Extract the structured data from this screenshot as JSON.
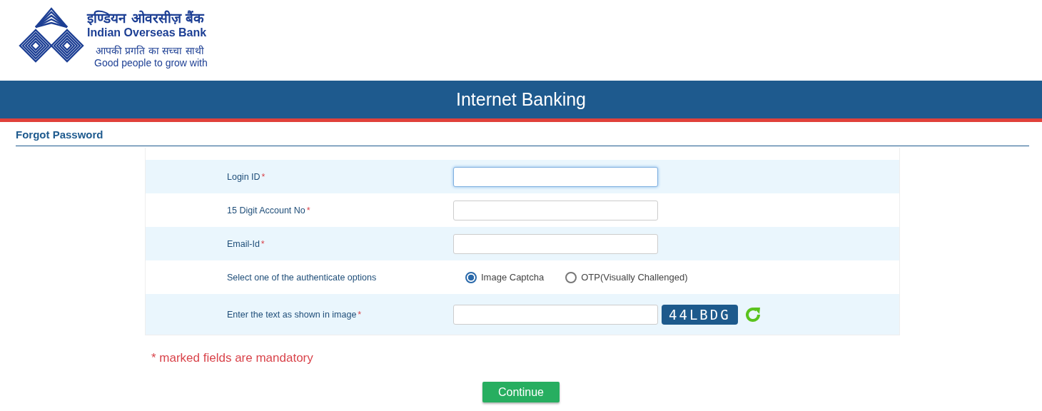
{
  "logo": {
    "name_hindi": "इण्डियन ओवरसीज़ बैंक",
    "name": "Indian Overseas Bank",
    "tagline_hindi": "आपकी प्रगति का सच्चा साथी",
    "tagline": "Good people to grow with"
  },
  "header": {
    "title": "Internet Banking"
  },
  "page": {
    "title": "Forgot Password"
  },
  "form": {
    "rows": [
      {
        "kind": "text",
        "label": "Login ID",
        "mark": "*",
        "focused": true
      },
      {
        "kind": "text",
        "label": "15 Digit Account No",
        "mark": "*",
        "focused": false
      },
      {
        "kind": "text",
        "label": "Email-Id",
        "mark": "*",
        "focused": false
      },
      {
        "kind": "radio",
        "label": "Select one of the authenticate options",
        "options": [
          {
            "label": "Image Captcha",
            "selected": true
          },
          {
            "label": "OTP(Visually Challenged)",
            "selected": false
          }
        ]
      },
      {
        "kind": "captcha",
        "label": "Enter the text as shown in image",
        "mark": "*",
        "focused": false,
        "captcha": "44LBDG"
      }
    ]
  },
  "note": "* marked fields are mandatory",
  "buttons": [
    {
      "label": "Continue"
    }
  ]
}
